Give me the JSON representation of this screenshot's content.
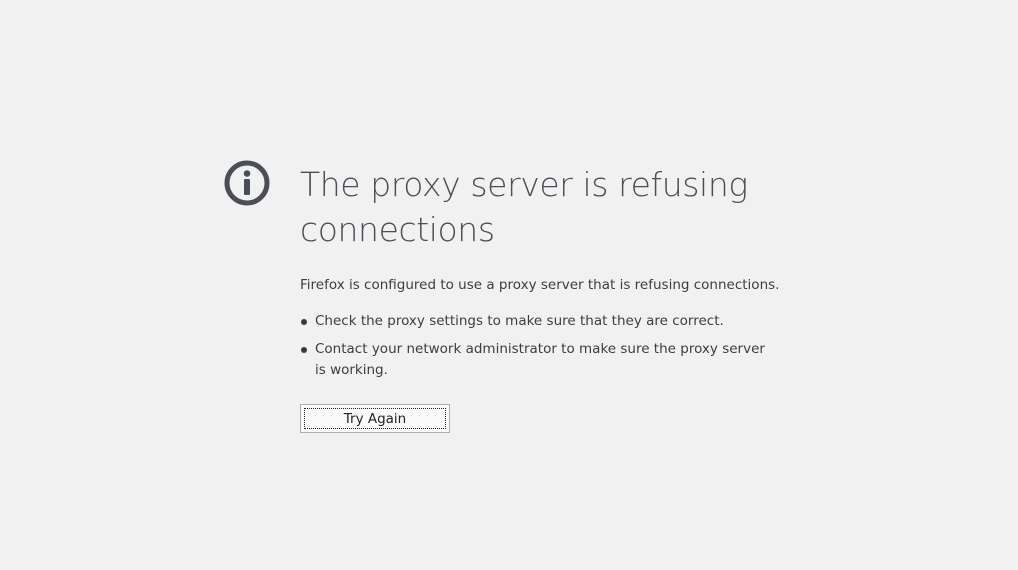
{
  "error_page": {
    "icon": "info-circle-icon",
    "title": "The proxy server is refusing connections",
    "description": "Firefox is configured to use a proxy server that is refusing connections.",
    "suggestions": [
      "Check the proxy settings to make sure that they are correct.",
      "Contact your network administrator to make sure the proxy server is working."
    ],
    "try_again_label": "Try Again"
  },
  "colors": {
    "background": "#f1f1f1",
    "icon": "#4a4f55",
    "title": "#4a4f55",
    "text": "#3d3d3d"
  }
}
